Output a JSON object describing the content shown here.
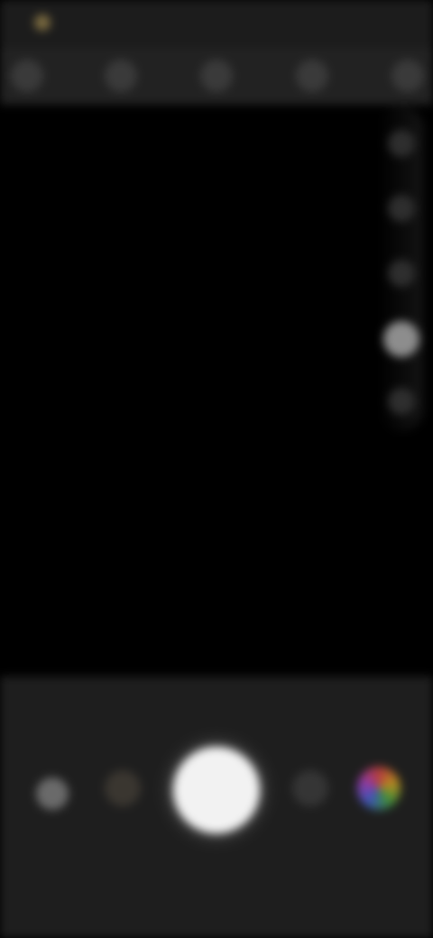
{
  "status_bar": {
    "indicator_icon": "notification-dot-icon",
    "text": ""
  },
  "top_toolbar": {
    "icons": [
      "flash-icon",
      "hdr-icon",
      "timer-icon",
      "aspect-ratio-icon",
      "settings-icon"
    ]
  },
  "side_controls": {
    "icons": [
      "zoom-icon",
      "grid-icon",
      "exposure-icon",
      "beauty-icon",
      "more-icon"
    ],
    "active_index": 3
  },
  "bottom_controls": {
    "gallery_icon": "gallery-thumbnail-icon",
    "filter_icon": "filter-icon",
    "shutter_icon": "shutter-icon",
    "switch_icon": "switch-camera-icon",
    "effects_icon": "color-effects-icon",
    "mode_label": "",
    "mode_label_2": ""
  },
  "colors": {
    "background": "#000000",
    "panel": "#1e1e1e",
    "toolbar": "#222222",
    "shutter": "#f2f2f2"
  }
}
